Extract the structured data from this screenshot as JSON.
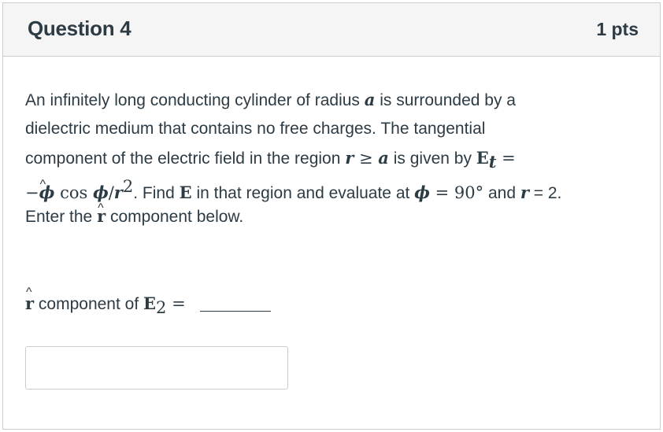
{
  "question": {
    "title": "Question 4",
    "points": "1 pts"
  },
  "body": {
    "line1_text": "An infinitely long conducting cylinder of radius ",
    "line1_var_a": "a",
    "line1_rest": " is surrounded by a",
    "line2_text": "dielectric medium that contains no free charges. The tangential",
    "line3_text": "component of the electric field in the region ",
    "line3_cond_r": "r",
    "line3_cond_ge": " ≥ ",
    "line3_cond_a": "a",
    "line3_mid": " is given by ",
    "line3_E": "E",
    "line3_t": "t",
    "line3_eq": " =",
    "line4_minus": "−",
    "line4_phi": "ϕ",
    "line4_cos": " cos ",
    "line4_phi2": "ϕ",
    "line4_slash": "/",
    "line4_r": "r",
    "line4_sq": "2",
    "line4_text": ". Find ",
    "line4_E": "E",
    "line4_text2": " in that region and evaluate at ",
    "line4_phi3": "ϕ",
    "line4_eq90": " = 90°",
    "line4_and": " and ",
    "line4_r2": "r",
    "line4_eq2": " = 2.",
    "line5_text": "Enter the ",
    "line5_rhat": "r",
    "line5_rest": " component below."
  },
  "answer": {
    "label_rhat": "r",
    "label_text": " component of ",
    "label_E": "E",
    "label_sub": "2",
    "label_eq": " =",
    "input_value": ""
  }
}
